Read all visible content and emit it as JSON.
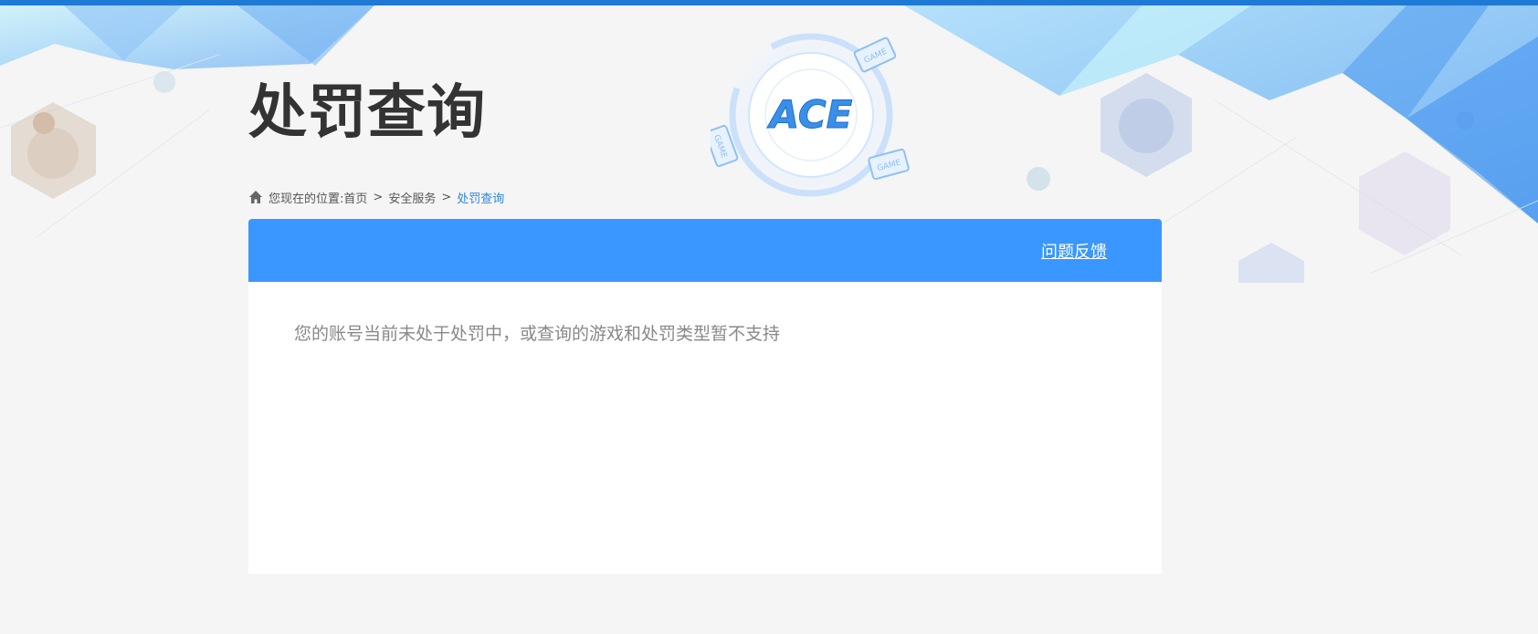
{
  "header": {
    "title": "处罚查询",
    "logo_text": "ACE",
    "logo_badges": [
      "GAME",
      "GAME",
      "GAME"
    ]
  },
  "breadcrumb": {
    "prefix": "您现在的位置:",
    "items": [
      "首页",
      "安全服务",
      "处罚查询"
    ],
    "separator": ">"
  },
  "panel": {
    "feedback_label": "问题反馈",
    "message": "您的账号当前未处于处罚中，或查询的游戏和处罚类型暂不支持"
  },
  "colors": {
    "accent": "#3a97ff",
    "topbar": "#1f7ad6",
    "link_current": "#2e86de",
    "background": "#f5f5f5"
  }
}
